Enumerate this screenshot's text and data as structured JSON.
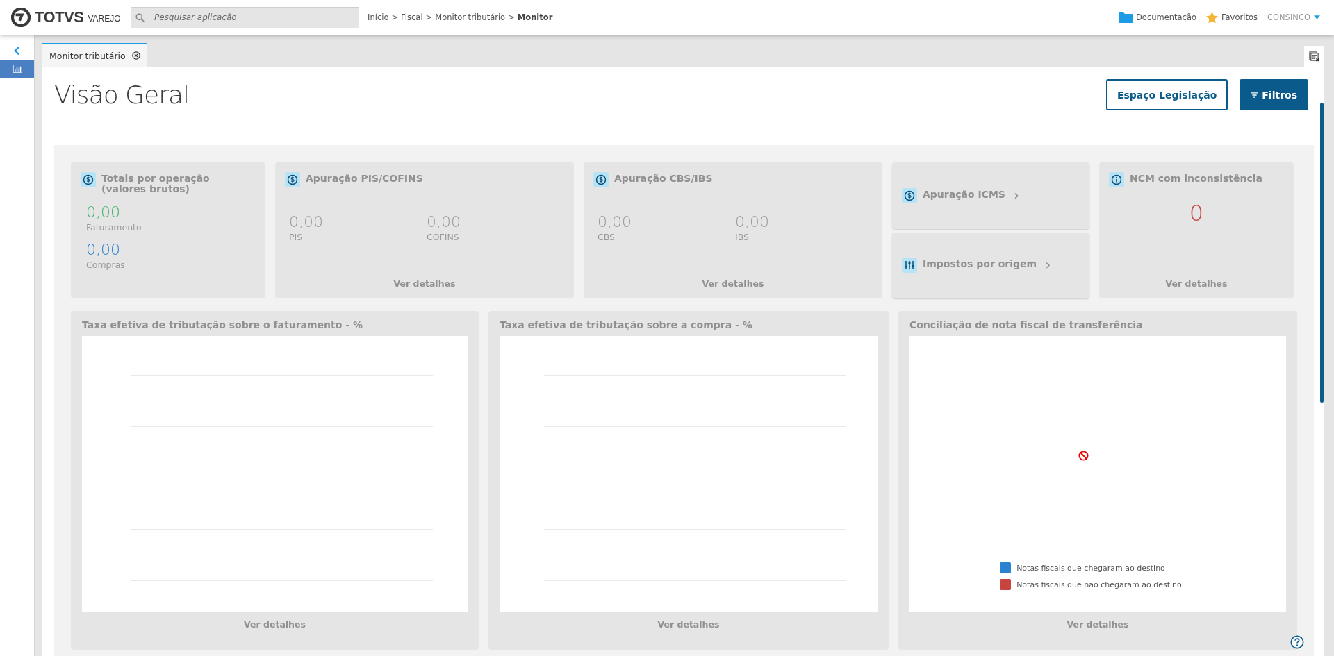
{
  "header": {
    "logo_text": "TOTVS",
    "logo_sub": "VAREJO",
    "search": {
      "placeholder": "Pesquisar aplicação"
    },
    "breadcrumb": [
      {
        "label": "Início",
        "current": false
      },
      {
        "label": "Fiscal",
        "current": false
      },
      {
        "label": "Monitor tributário",
        "current": false
      },
      {
        "label": "Monitor",
        "current": true
      }
    ],
    "breadcrumb_separator": ">",
    "links": [
      {
        "kind": "folder",
        "label": "Documentação"
      },
      {
        "kind": "star",
        "label": "Favoritos"
      },
      {
        "kind": "user",
        "label": "CONSINCO"
      }
    ]
  },
  "sidebar": {
    "items": [
      {
        "kind": "back",
        "selected": false
      },
      {
        "kind": "chart",
        "selected": true
      }
    ]
  },
  "tabs": [
    {
      "label": "Monitor tributário",
      "selected": true
    }
  ],
  "page": {
    "title": "Visão Geral",
    "buttons": [
      {
        "label": "Espaço Legislação",
        "kind": "outline"
      },
      {
        "label": "Filtros",
        "kind": "primary"
      }
    ]
  },
  "cards": [
    {
      "kind": "stack",
      "title": "Totais por operação (valores brutos)",
      "values": [
        {
          "value": "0,00",
          "label": "Faturamento",
          "color": "#3db36b"
        },
        {
          "value": "0,00",
          "label": "Compras",
          "color": "#2b7fd4"
        }
      ]
    },
    {
      "kind": "pair",
      "title": "Apuração PIS/COFINS",
      "values": [
        {
          "value": "0,00",
          "label": "PIS"
        },
        {
          "value": "0,00",
          "label": "COFINS"
        }
      ],
      "link": "Ver detalhes"
    },
    {
      "kind": "pair",
      "title": "Apuração CBS/IBS",
      "values": [
        {
          "value": "0,00",
          "label": "CBS"
        },
        {
          "value": "0,00",
          "label": "IBS"
        }
      ],
      "link": "Ver detalhes"
    },
    {
      "kind": "nav",
      "items": [
        {
          "title": "Apuração ICMS",
          "chevron": "›"
        },
        {
          "title": "Impostos por origem",
          "chevron": "›"
        }
      ]
    },
    {
      "kind": "count",
      "title": "NCM com inconsistência",
      "value": "0",
      "link": "Ver detalhes"
    }
  ],
  "charts": [
    {
      "kind": "lines",
      "title": "Taxa efetiva de tributação sobre o faturamento - %",
      "link": "Ver detalhes"
    },
    {
      "kind": "lines",
      "title": "Taxa efetiva de tributação sobre a compra - %",
      "link": "Ver detalhes"
    },
    {
      "kind": "nodata",
      "title": "Conciliação de nota fiscal de transferência",
      "legend": [
        {
          "label": "Notas fiscais que chegaram ao destino",
          "color": "#2b82d0"
        },
        {
          "label": "Notas fiscais que não chegaram ao destino",
          "color": "#c8453f"
        }
      ],
      "link": "Ver detalhes"
    }
  ]
}
